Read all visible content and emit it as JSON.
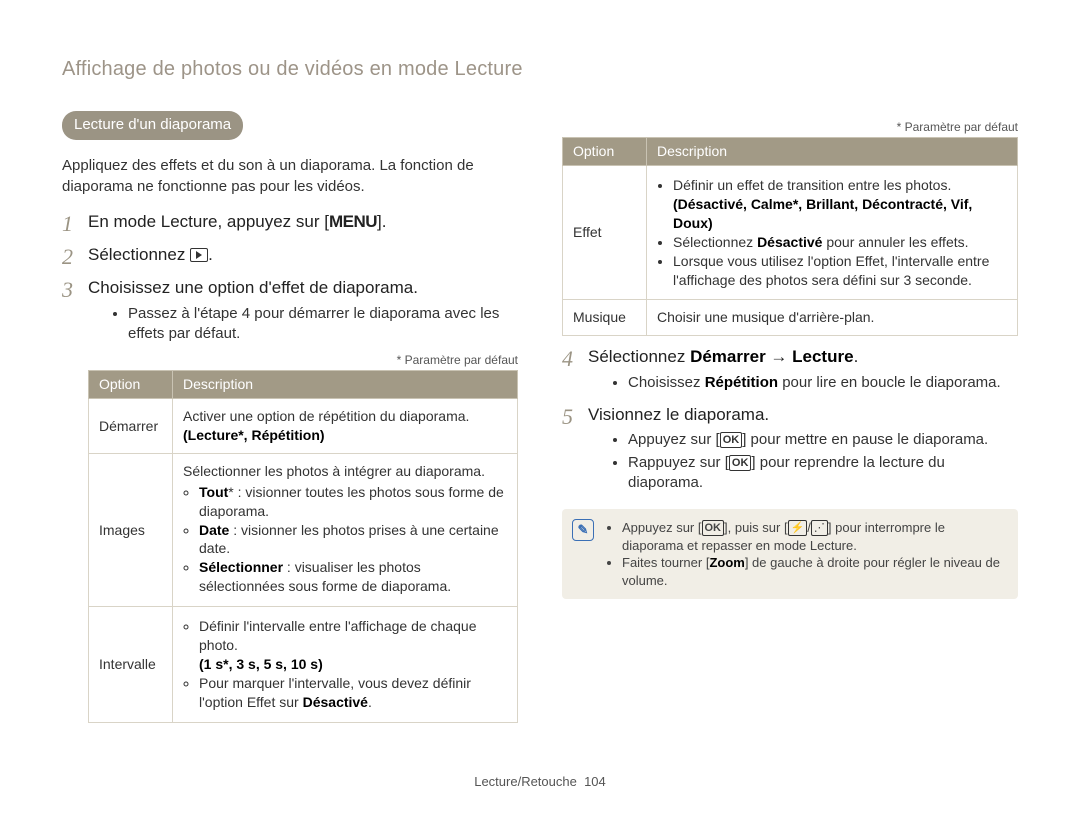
{
  "page_header": "Affichage de photos ou de vidéos en mode Lecture",
  "footer": {
    "section": "Lecture/Retouche",
    "page": "104"
  },
  "footnote": "* Paramètre par défaut",
  "table_head": {
    "option": "Option",
    "description": "Description"
  },
  "left": {
    "pill": "Lecture d'un diaporama",
    "intro": "Appliquez des effets et du son à un diaporama. La fonction de diaporama ne fonctionne pas pour les vidéos.",
    "step1_a": "En mode Lecture, appuyez sur [",
    "step1_menu": "MENU",
    "step1_b": "].",
    "step2_a": "Sélectionnez ",
    "step2_b": ".",
    "step3": "Choisissez une option d'effet de diaporama.",
    "step3_bullet": "Passez à l'étape 4 pour démarrer le diaporama avec les effets par défaut.",
    "table": [
      {
        "name": "Démarrer",
        "line1": "Activer une option de répétition du diaporama.",
        "bold": "(Lecture*, Répétition)"
      },
      {
        "name": "Images",
        "line1": "Sélectionner les photos à intégrer au diaporama.",
        "b1a": "Tout",
        "b1b": "* : visionner toutes les photos sous forme de diaporama.",
        "b2a": "Date",
        "b2b": " : visionner les photos prises à une certaine date.",
        "b3a": "Sélectionner",
        "b3b": " : visualiser les photos sélectionnées sous forme de diaporama."
      },
      {
        "name": "Intervalle",
        "b1": "Définir l'intervalle entre l'affichage de chaque photo.",
        "bold": "(1 s*, 3 s, 5 s, 10 s)",
        "b2a": "Pour marquer l'intervalle, vous devez définir l'option Effet sur ",
        "b2b": "Désactivé",
        "b2c": "."
      }
    ]
  },
  "right": {
    "table": [
      {
        "name": "Effet",
        "b1": "Définir un effet de transition entre les photos.",
        "bold_a": "(Désactivé, Calme*, Brillant, Décontracté, Vif, Doux)",
        "b2a": "Sélectionnez ",
        "b2b": "Désactivé",
        "b2c": " pour annuler les effets.",
        "b3": "Lorsque vous utilisez l'option Effet, l'intervalle entre l'affichage des photos sera défini sur 3 seconde."
      },
      {
        "name": "Musique",
        "line1": "Choisir une musique d'arrière-plan."
      }
    ],
    "step4_a": "Sélectionnez ",
    "step4_b": "Démarrer",
    "step4_c": " → ",
    "step4_d": "Lecture",
    "step4_e": ".",
    "step4_bullet_a": "Choisissez ",
    "step4_bullet_b": "Répétition",
    "step4_bullet_c": " pour lire en boucle le diaporama.",
    "step5": "Visionnez le diaporama.",
    "step5_b1_a": "Appuyez sur [",
    "step5_b1_ok": "OK",
    "step5_b1_b": "] pour mettre en pause le diaporama.",
    "step5_b2_a": "Rappuyez sur [",
    "step5_b2_ok": "OK",
    "step5_b2_b": "] pour reprendre la lecture du diaporama.",
    "note": {
      "b1_a": "Appuyez sur [",
      "b1_ok": "OK",
      "b1_b": "], puis sur [",
      "b1_bolt": "⚡",
      "b1_c": "/",
      "b1_wifi": "⋰",
      "b1_d": "] pour interrompre le diaporama et repasser en mode Lecture.",
      "b2_a": "Faites tourner [",
      "b2_b": "Zoom",
      "b2_c": "] de gauche à droite pour régler le niveau de volume."
    }
  }
}
